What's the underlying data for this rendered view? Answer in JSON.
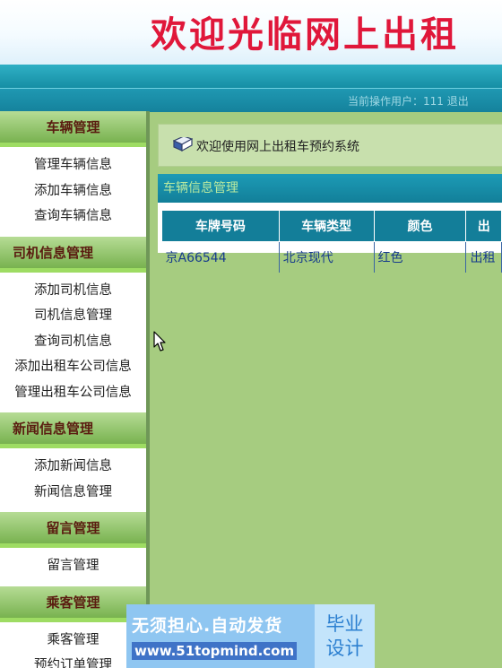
{
  "header": {
    "title": "欢迎光临网上出租"
  },
  "user_bar": {
    "text": "当前操作用户：111   退出"
  },
  "sidebar": {
    "sections": [
      {
        "title": "车辆管理",
        "items": [
          "管理车辆信息",
          "添加车辆信息",
          "查询车辆信息"
        ]
      },
      {
        "title": "司机信息管理",
        "items": [
          "添加司机信息",
          "司机信息管理",
          "查询司机信息",
          "添加出租车公司信息",
          "管理出租车公司信息"
        ]
      },
      {
        "title": "新闻信息管理",
        "items": [
          "添加新闻信息",
          "新闻信息管理"
        ]
      },
      {
        "title": "留言管理",
        "items": [
          "留言管理"
        ]
      },
      {
        "title": "乘客管理",
        "items": [
          "乘客管理",
          "预约订单管理"
        ]
      }
    ]
  },
  "welcome": {
    "text": "欢迎使用网上出租车预约系统"
  },
  "panel": {
    "title": "车辆信息管理",
    "columns": [
      "车牌号码",
      "车辆类型",
      "颜色",
      "出"
    ],
    "rows": [
      [
        "京A66544",
        "北京现代",
        "红色",
        "出租"
      ]
    ]
  },
  "watermark": {
    "line1": "无须担心.自动发货",
    "line2": "www.51topmind.com",
    "badge1": "毕业",
    "badge2": "设计"
  },
  "colors": {
    "teal": "#168ea4",
    "green_bg": "#a6cc80",
    "title_red": "#e0173a"
  }
}
